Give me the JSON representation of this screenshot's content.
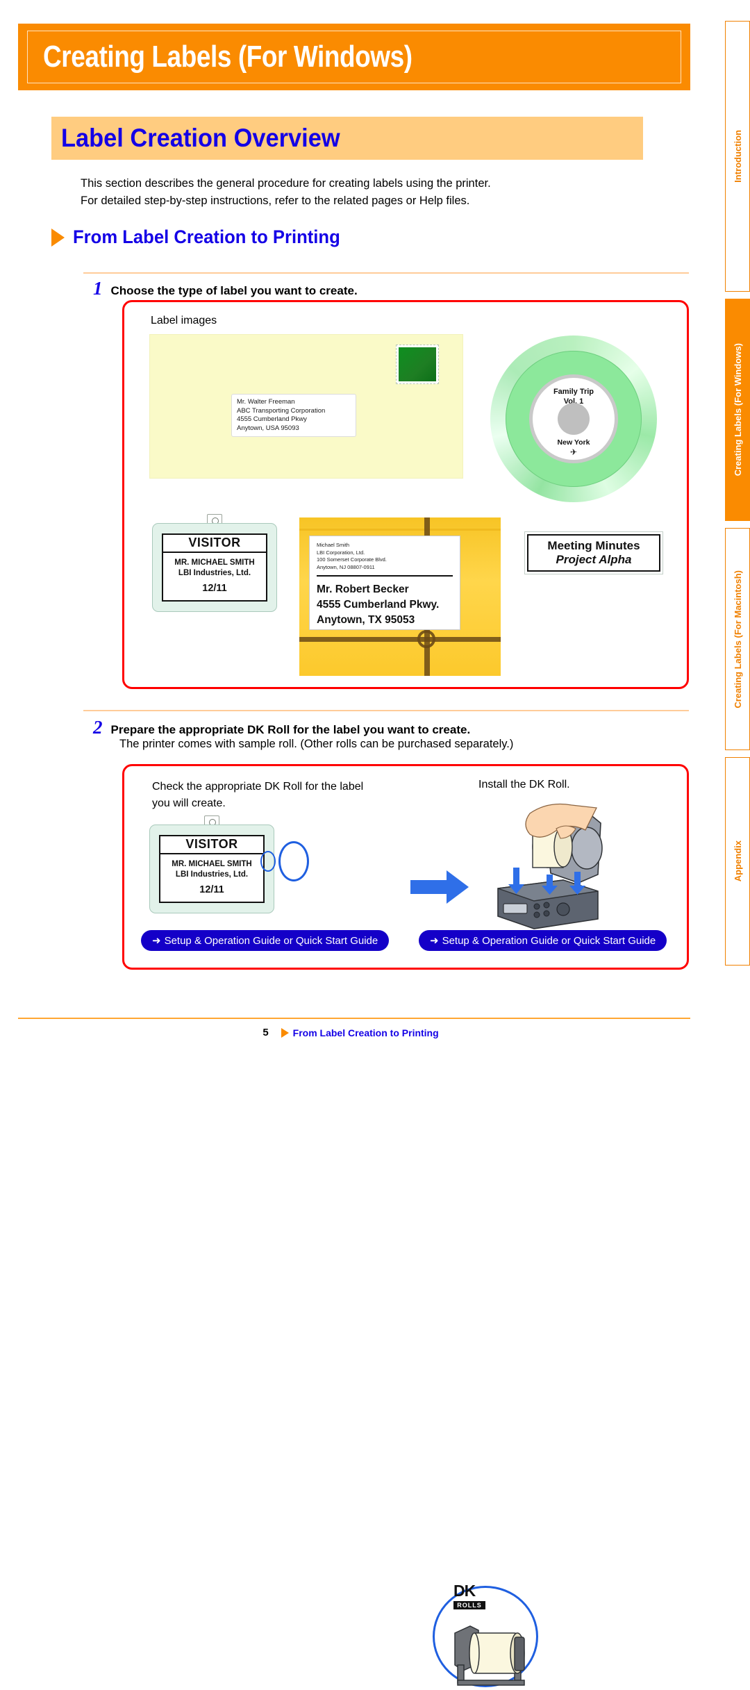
{
  "chapter": {
    "title": "Creating Labels (For Windows)"
  },
  "section": {
    "title": "Label Creation Overview"
  },
  "intro": {
    "line1": "This section describes the general procedure for creating labels using the printer.",
    "line2": "For detailed step-by-step instructions, refer to the related pages or Help files."
  },
  "subhead": {
    "text": "From Label Creation to Printing"
  },
  "steps": [
    {
      "number": "1",
      "label": "Choose the type of label you want to create.",
      "caption": "Label images"
    },
    {
      "number": "2",
      "label": "Prepare the appropriate DK Roll  for the label you want to create.",
      "sub": "The printer comes with sample roll. (Other rolls can be purchased separately.)",
      "caption_left_line1": "Check the appropriate DK Roll  for the label",
      "caption_left_line2": "you will create.",
      "caption_right": "Install the DK Roll."
    }
  ],
  "envelope": {
    "address": "Mr. Walter Freeman\nABC Transporting Corporation\n4555 Cumberland Pkwy\nAnytown, USA 95093"
  },
  "cd": {
    "title_line1": "Family Trip",
    "title_line2": "Vol. 1",
    "subtitle": "New York",
    "icon": "photo-icon"
  },
  "badge": {
    "header": "VISITOR",
    "name": "MR. MICHAEL SMITH",
    "company": "LBI Industries, Ltd.",
    "date": "12/11"
  },
  "package_label": {
    "from": "Michael Smith\nLBI Corporation, Ltd.\n100 Somerset Corporate Blvd.\nAnytown, NJ  08807-0911",
    "to_line1": "Mr. Robert Becker",
    "to_line2": "4555 Cumberland Pkwy.",
    "to_line3": "Anytown, TX  95053"
  },
  "binder_label": {
    "line1": "Meeting Minutes",
    "line2": "Project Alpha"
  },
  "dk_roll": {
    "logo_dk": "DK",
    "logo_rolls": "ROLLS"
  },
  "links": {
    "arrow_glyph": "➜",
    "left": "Setup & Operation Guide or Quick Start Guide",
    "right": "Setup & Operation Guide or Quick Start Guide"
  },
  "tabs": [
    {
      "label": "Introduction",
      "active": false
    },
    {
      "label": "Creating Labels (For Windows)",
      "active": true
    },
    {
      "label": "Creating Labels (For Macintosh)",
      "active": false
    },
    {
      "label": "Appendix",
      "active": false
    }
  ],
  "footer": {
    "page": "5",
    "link": "From Label Creation to Printing"
  },
  "colors": {
    "orange": "#FA8B01",
    "light_orange": "#FFCC80",
    "blue": "#1400E6",
    "link_blue": "#1400C8",
    "red_box": "#FF0000"
  }
}
